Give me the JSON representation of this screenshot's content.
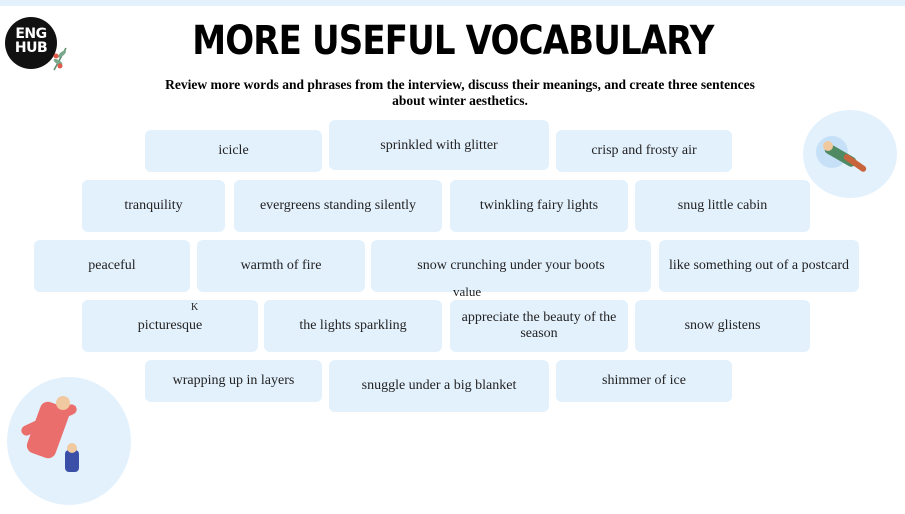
{
  "logo": {
    "line1": "ENG",
    "line2": "HUB"
  },
  "title": "MORE USEFUL VOCABULARY",
  "subtitle": "Review more words and phrases from the interview, discuss their meanings, and create three sentences about winter aesthetics.",
  "cards": [
    "icicle",
    "sprinkled with glitter",
    "crisp and frosty air",
    "tranquility",
    "evergreens standing silently",
    "twinkling fairy lights",
    "snug little cabin",
    "peaceful",
    "warmth of fire",
    "snow crunching under your boots",
    "like something out of a postcard",
    "picturesque",
    "the lights sparkling",
    "appreciate the beauty of the season",
    "snow glistens",
    "wrapping up in layers",
    "snuggle under a big blanket",
    "shimmer of ice"
  ],
  "stray": {
    "k": "K",
    "value": "value"
  }
}
